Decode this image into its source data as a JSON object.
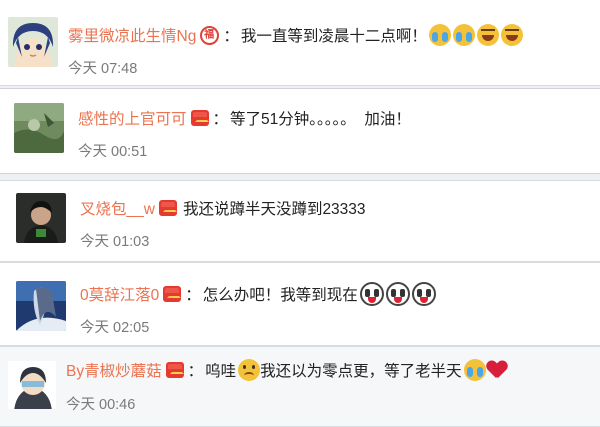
{
  "comments": [
    {
      "username": "雾里微凉此生情Ng",
      "separator": "：",
      "text": "我一直等到凌晨十二点啊！",
      "time": "今天 07:48",
      "badge_char": "福",
      "emojis": [
        "crying-laughing-icon",
        "crying-laughing-icon",
        "grinning-icon",
        "grinning-icon"
      ]
    },
    {
      "username": "感性的上官可可",
      "separator": "：",
      "text": "等了51分钟。。。。。  加油！",
      "time": "今天 00:51"
    },
    {
      "username": "叉烧包__w",
      "separator": "",
      "text": "我还说蹲半天没蹲到23333",
      "time": "今天 01:03"
    },
    {
      "username": "0莫辞江落0",
      "separator": "：",
      "text": "怎么办吧！我等到现在",
      "time": "今天 02:05",
      "emojis": [
        "shocked-face-icon",
        "shocked-face-icon",
        "shocked-face-icon"
      ]
    },
    {
      "username": "By青椒炒蘑菇",
      "separator": "：",
      "text_a": "呜哇",
      "text_b": "我还以为零点更，等了老半天",
      "time": "今天 00:46",
      "emojis": [
        "sad-face-icon",
        "crying-laughing-icon",
        "broken-heart-icon"
      ]
    }
  ],
  "colors": {
    "username": "#eb7350",
    "text": "#222222",
    "time": "#7a7a7a",
    "badge": "#e53a2f",
    "background": "#eef0f3"
  }
}
